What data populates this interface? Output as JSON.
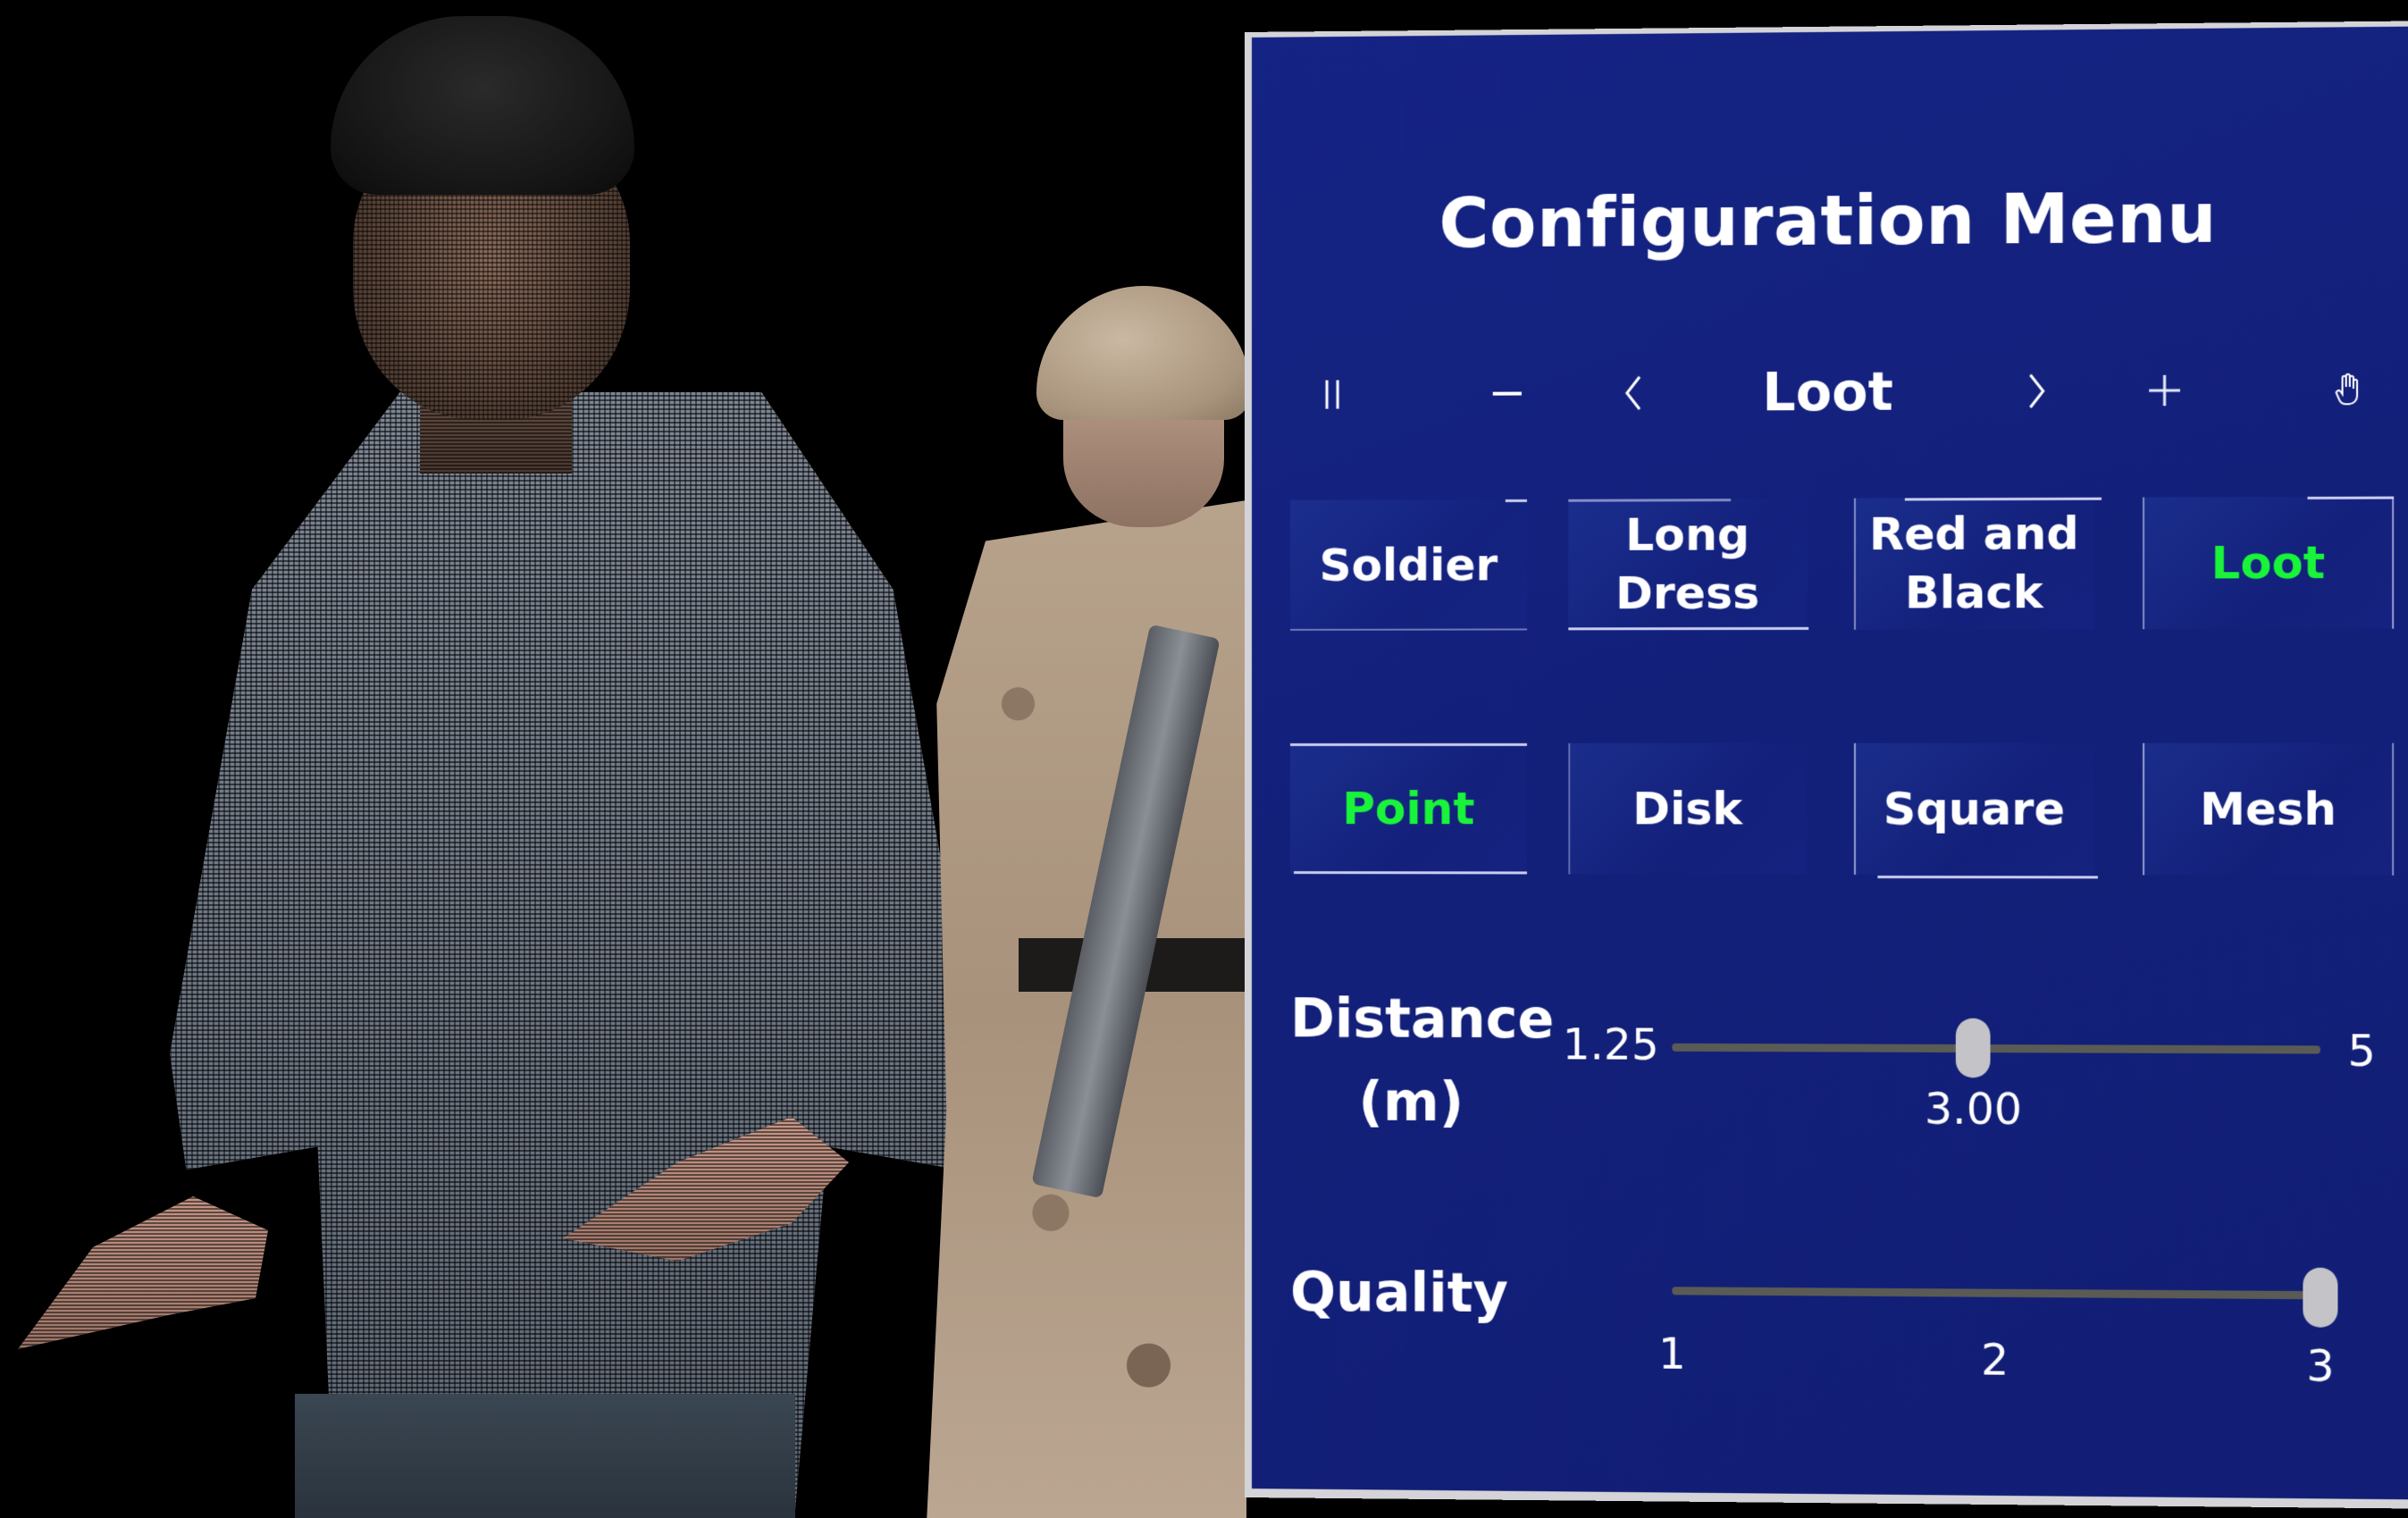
{
  "scene": {
    "foreground_subject": "point-cloud-person",
    "background_subject": "soldier"
  },
  "panel": {
    "title": "Configuration Menu",
    "toolbar": {
      "pause_icon": "pause-icon",
      "minus_icon": "minus-icon",
      "prev_icon": "chevron-left-icon",
      "current_label": "Loot",
      "next_icon": "chevron-right-icon",
      "plus_icon": "plus-icon",
      "hand_icon": "hand-grab-icon"
    },
    "models": [
      {
        "label": "Soldier",
        "active": false
      },
      {
        "label": "Long\nDress",
        "active": false
      },
      {
        "label": "Red and\nBlack",
        "active": false
      },
      {
        "label": "Loot",
        "active": true
      }
    ],
    "render_modes": [
      {
        "label": "Point",
        "active": true
      },
      {
        "label": "Disk",
        "active": false
      },
      {
        "label": "Square",
        "active": false
      },
      {
        "label": "Mesh",
        "active": false
      }
    ],
    "distance": {
      "label_line1": "Distance",
      "label_line2": "(m)",
      "min_label": "1.25",
      "max_label": "5",
      "min": 1.25,
      "max": 5,
      "value": 3.0,
      "value_label": "3.00"
    },
    "quality": {
      "label": "Quality",
      "ticks": [
        "1",
        "2",
        "3"
      ],
      "min": 1,
      "max": 3,
      "value": 3
    },
    "colors": {
      "active_text": "#19f43a",
      "panel_bg": "#13207a",
      "panel_border": "#d4d4d8"
    }
  }
}
